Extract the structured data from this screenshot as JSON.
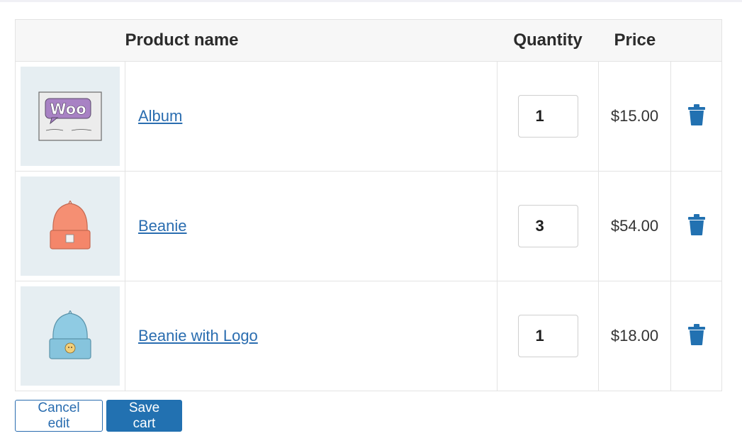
{
  "cart": {
    "columns": {
      "name": "Product name",
      "quantity": "Quantity",
      "price": "Price"
    },
    "items": [
      {
        "name": "Album",
        "quantity": "1",
        "price": "$15.00",
        "image_icon": "album-thumbnail-icon",
        "image_text": "Woo"
      },
      {
        "name": "Beanie",
        "quantity": "3",
        "price": "$54.00",
        "image_icon": "orange-beanie-thumbnail-icon"
      },
      {
        "name": "Beanie with Logo",
        "quantity": "1",
        "price": "$18.00",
        "image_icon": "blue-beanie-thumbnail-icon"
      }
    ],
    "remove_icon": "trash-icon"
  },
  "actions": {
    "cancel_label": "Cancel edit",
    "save_label": "Save cart"
  },
  "colors": {
    "accent": "#2271b1",
    "link": "#2a6db0",
    "thumb_bg": "#e6eef2",
    "beanie_orange": "#f58f73",
    "beanie_blue": "#8fcbe3",
    "woo_purple": "#a882c4"
  }
}
